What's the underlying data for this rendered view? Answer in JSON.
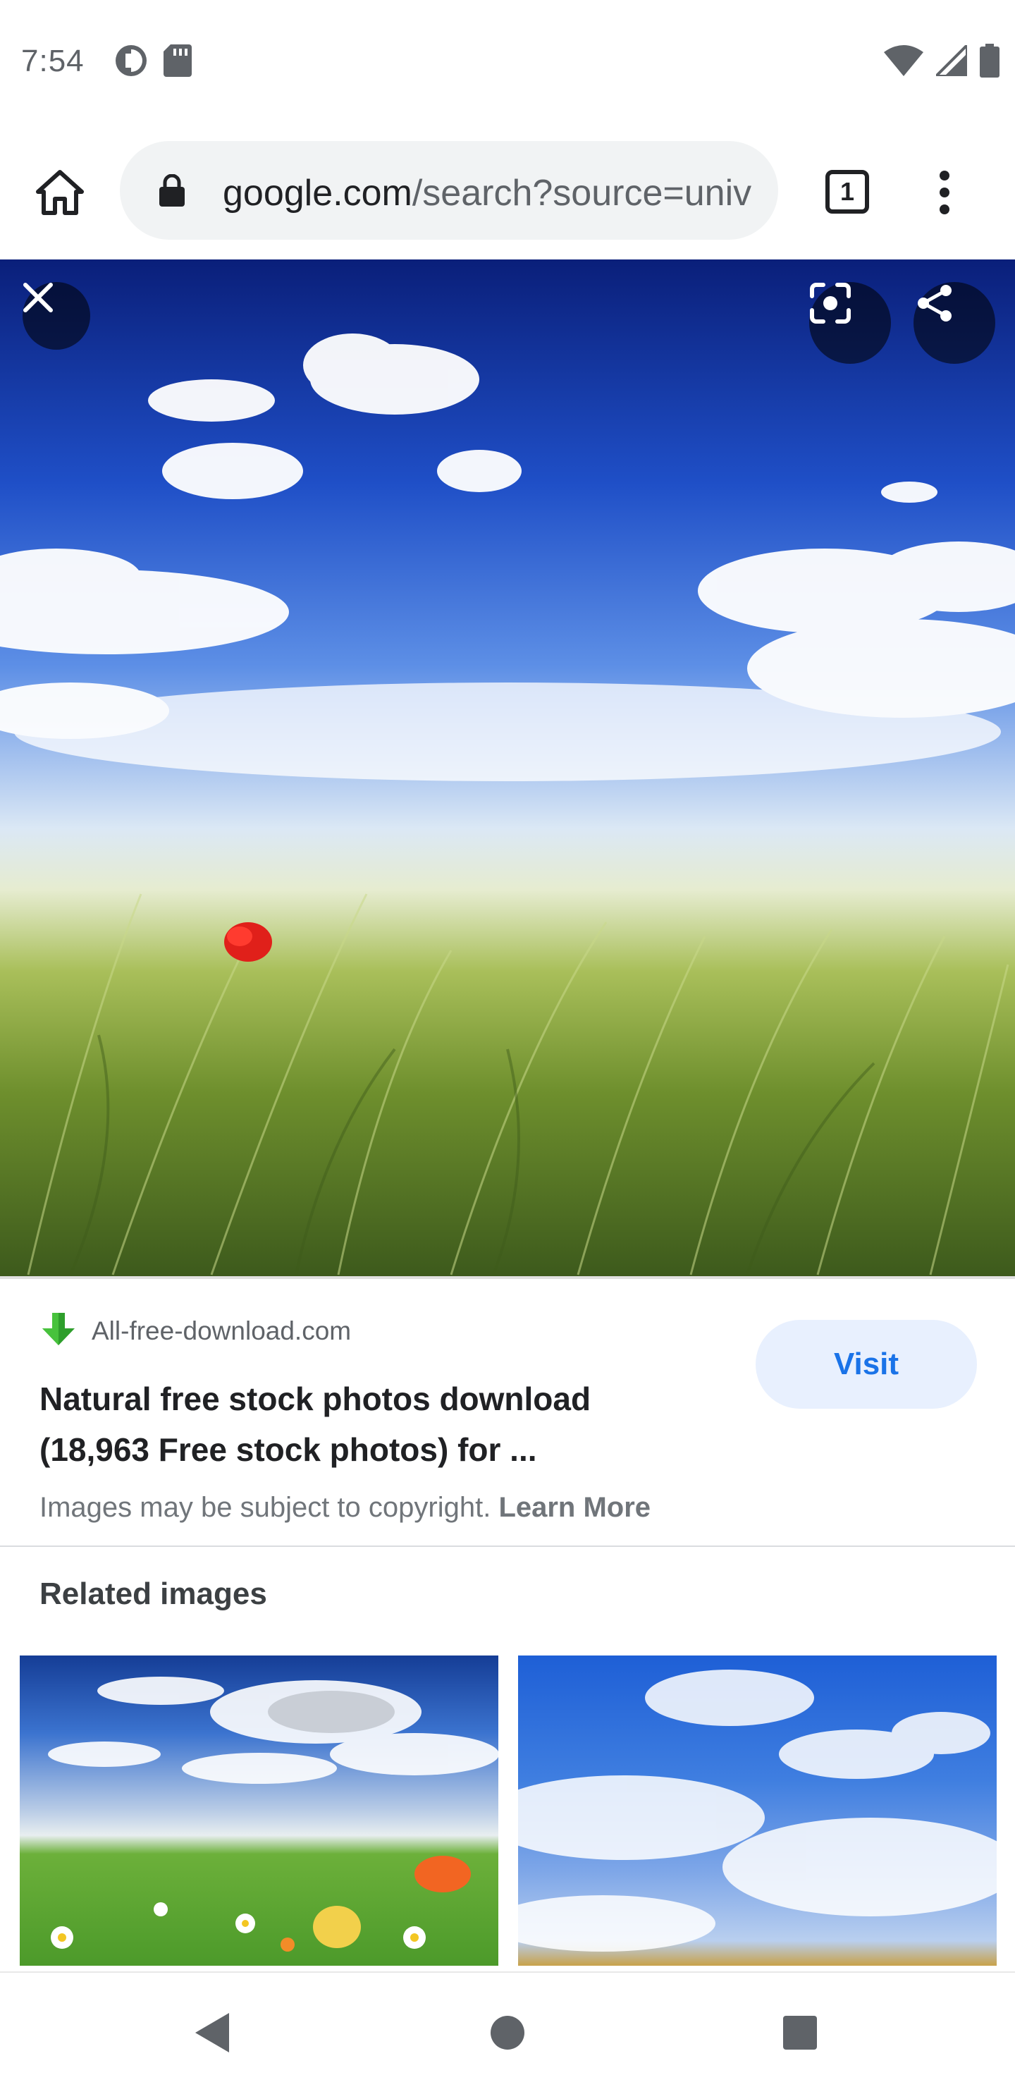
{
  "status_bar": {
    "time": "7:54",
    "left_icons": [
      "data-saver-icon",
      "sd-card-icon"
    ],
    "right_icons": [
      "wifi-icon",
      "signal-icon",
      "battery-icon"
    ]
  },
  "toolbar": {
    "url_host": "google.com",
    "url_path": "/search?source=univ",
    "tab_count": "1",
    "icons": [
      "home-icon",
      "lock-icon",
      "tab-switcher-icon",
      "overflow-menu-icon"
    ]
  },
  "image_viewer": {
    "icons": [
      "close-icon",
      "google-lens-icon",
      "share-icon"
    ]
  },
  "result": {
    "source": "All-free-download.com",
    "title_line1": "Natural free stock photos download",
    "title_line2": "(18,963 Free stock photos) for ...",
    "copyright_text": "Images may be subject to copyright.",
    "learn_more": "Learn More",
    "visit_label": "Visit"
  },
  "related": {
    "heading": "Related images"
  },
  "nav_bar": {
    "icons": [
      "back-icon",
      "home-circle-icon",
      "recents-icon"
    ]
  },
  "colors": {
    "accent": "#1a73e8",
    "visit_bg": "#e8f0fe",
    "url_pill": "#f1f3f4"
  }
}
